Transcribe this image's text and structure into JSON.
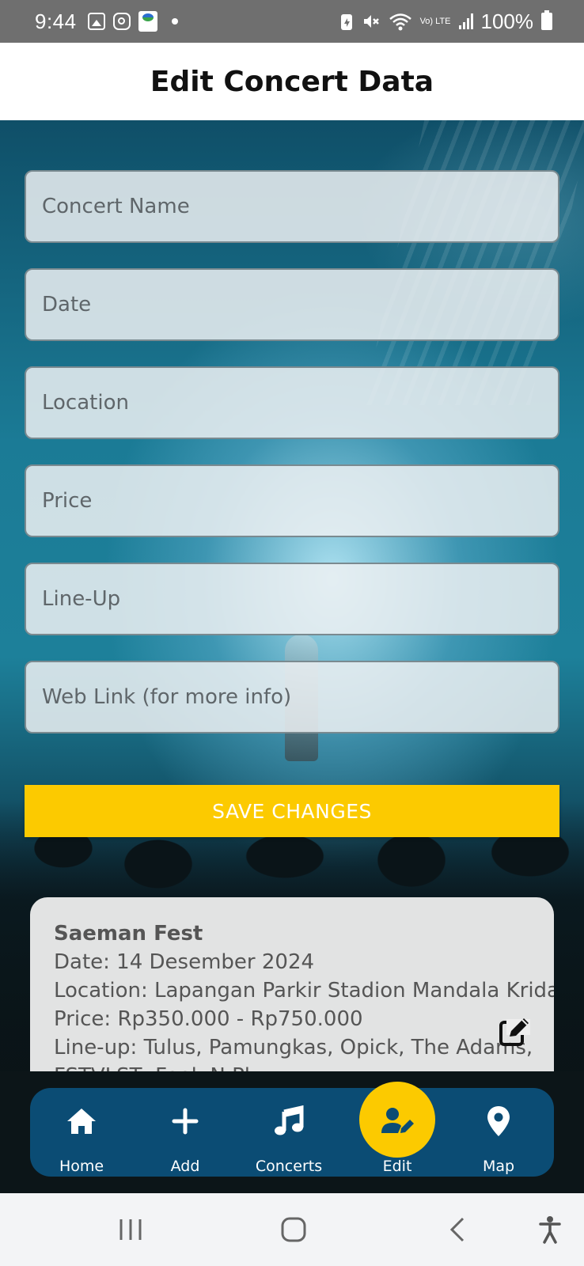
{
  "status_bar": {
    "time": "9:44",
    "battery": "100%",
    "network": "Vo) LTE"
  },
  "header": {
    "title": "Edit Concert Data"
  },
  "form": {
    "concert_name_placeholder": "Concert Name",
    "date_placeholder": "Date",
    "location_placeholder": "Location",
    "price_placeholder": "Price",
    "lineup_placeholder": "Line-Up",
    "weblink_placeholder": "Web Link (for more info)",
    "save_label": "SAVE CHANGES"
  },
  "concert_card": {
    "title": "Saeman Fest",
    "date": "Date: 14 Desember 2024",
    "location": "Location: Lapangan Parkir Stadion Mandala Krida",
    "price": "Price: Rp350.000 - Rp750.000",
    "lineup": "Line-up: Tulus, Pamungkas, Opick, The Adams,",
    "lineup_cont": "FSTVLST, Feel..N Pl..."
  },
  "bottom_nav": {
    "items": [
      {
        "label": "Home",
        "icon": "home-icon"
      },
      {
        "label": "Add",
        "icon": "plus-icon"
      },
      {
        "label": "Concerts",
        "icon": "music-note-icon"
      },
      {
        "label": "Edit",
        "icon": "user-edit-icon",
        "active": true
      },
      {
        "label": "Map",
        "icon": "map-pin-icon"
      }
    ]
  },
  "colors": {
    "accent": "#fcca00",
    "nav_bg": "#0b4c74",
    "header_bg": "#ffffff"
  }
}
